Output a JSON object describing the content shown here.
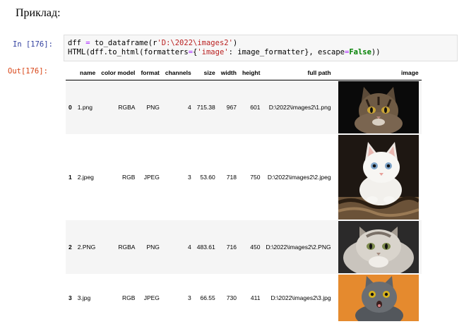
{
  "heading": "Приклад:",
  "cell": {
    "in_prompt": "In [176]:",
    "out_prompt": "Out[176]:",
    "code_line1": {
      "a": "dff ",
      "op": "=",
      "b": " to_dataframe(r",
      "str": "'D:\\2022\\images2'",
      "c": ")"
    },
    "code_line2": {
      "a": "HTML(dff.to_html(formatters",
      "op1": "=",
      "b": "{",
      "str": "'image'",
      "c": ": image_formatter}, escape",
      "op2": "=",
      "kw": "False",
      "d": "))"
    }
  },
  "table": {
    "columns": [
      "name",
      "color model",
      "format",
      "channels",
      "size",
      "width",
      "height",
      "full path",
      "image"
    ],
    "rows": [
      {
        "index": "0",
        "name": "1.png",
        "color_model": "RGBA",
        "format": "PNG",
        "channels": "4",
        "size": "715.38",
        "width": "967",
        "height": "601",
        "full_path": "D:\\2022\\images2\\1.png",
        "image": "tabby-kitten-photo"
      },
      {
        "index": "1",
        "name": "2.jpeg",
        "color_model": "RGB",
        "format": "JPEG",
        "channels": "3",
        "size": "53.60",
        "width": "718",
        "height": "750",
        "full_path": "D:\\2022\\images2\\2.jpeg",
        "image": "white-kitten-photo"
      },
      {
        "index": "2",
        "name": "2.PNG",
        "color_model": "RGBA",
        "format": "PNG",
        "channels": "4",
        "size": "483.61",
        "width": "716",
        "height": "450",
        "full_path": "D:\\2022\\images2\\2.PNG",
        "image": "fluffy-cat-photo"
      },
      {
        "index": "3",
        "name": "3.jpg",
        "color_model": "RGB",
        "format": "JPEG",
        "channels": "3",
        "size": "66.55",
        "width": "730",
        "height": "411",
        "full_path": "D:\\2022\\images2\\3.jpg",
        "image": "gray-cat-orange-bg-photo"
      }
    ]
  },
  "colors": {
    "in_prompt": "#303f9f",
    "out_prompt": "#d84315",
    "row_stripe": "#f5f5f5",
    "string": "#ba2121",
    "keyword": "#008000",
    "operator": "#aa22ff"
  }
}
